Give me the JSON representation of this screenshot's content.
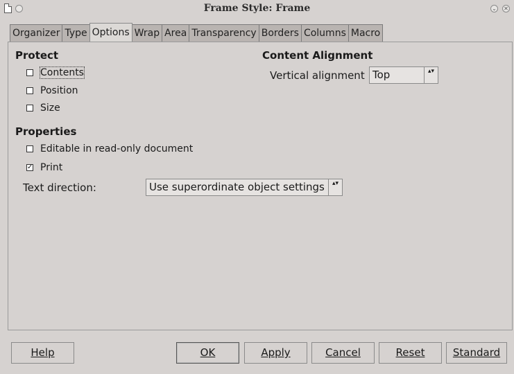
{
  "window": {
    "title": "Frame Style: Frame",
    "icons": [
      "document-icon",
      "window-menu-icon",
      "minimize-icon",
      "close-icon"
    ]
  },
  "tabs": [
    "Organizer",
    "Type",
    "Options",
    "Wrap",
    "Area",
    "Transparency",
    "Borders",
    "Columns",
    "Macro"
  ],
  "active_tab": "Options",
  "protect": {
    "heading": "Protect",
    "contents": {
      "label": "Contents",
      "checked": false
    },
    "position": {
      "label": "Position",
      "checked": false
    },
    "size": {
      "label": "Size",
      "checked": false
    }
  },
  "content_alignment": {
    "heading": "Content Alignment",
    "vertical_label": "Vertical alignment",
    "vertical_value": "Top"
  },
  "properties": {
    "heading": "Properties",
    "editable": {
      "label": "Editable in read-only document",
      "checked": false
    },
    "print": {
      "label": "Print",
      "checked": true,
      "mark": "✓"
    },
    "text_direction_label": "Text direction:",
    "text_direction_value": "Use superordinate object settings"
  },
  "buttons": {
    "help": "Help",
    "ok": "OK",
    "apply": "Apply",
    "cancel": "Cancel",
    "reset": "Reset",
    "standard": "Standard"
  },
  "spinner_glyph": "▴▾",
  "close_glyph": "✕",
  "min_glyph": "⌄"
}
